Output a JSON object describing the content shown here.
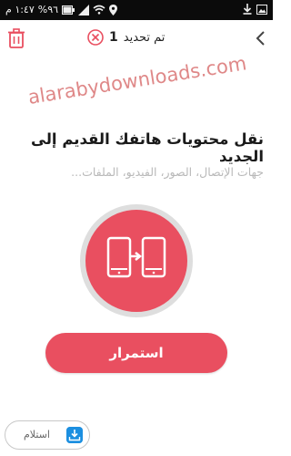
{
  "status_bar": {
    "time": "١:٤٧ م",
    "battery": "%٩٦"
  },
  "header": {
    "update_count": "1",
    "update_label": "تم تحديد"
  },
  "watermark": "alarabydownloads.com",
  "main": {
    "title": "نقل محتويات هاتفك القديم إلى الجديد",
    "subtitle": "جهات الإتصال، الصور، الفيديو، الملفات..."
  },
  "continue_button": {
    "label": "استمرار"
  },
  "receive_button": {
    "label": "استلام"
  },
  "colors": {
    "accent": "#e94f60",
    "ring": "#d9d9d9",
    "receive_icon": "#1c8fe0"
  }
}
